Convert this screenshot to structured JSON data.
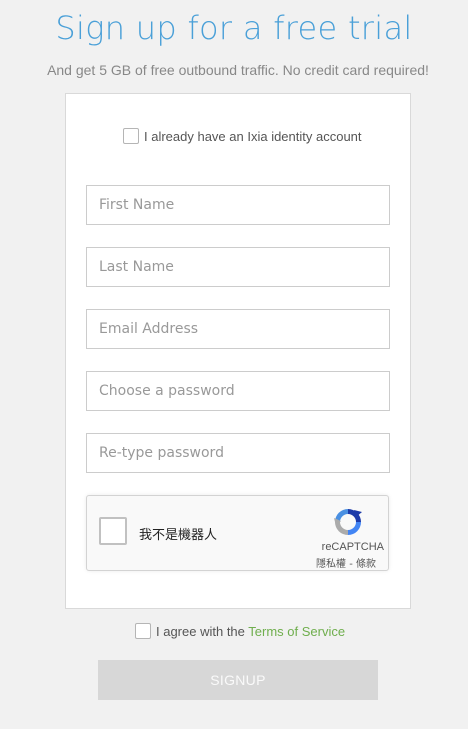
{
  "header": {
    "title": "Sign up for a free trial",
    "subtitle": "And get 5 GB of free outbound traffic. No credit card required!"
  },
  "form": {
    "identity_label": "I already have an Ixia identity account",
    "first_name_placeholder": "First Name",
    "last_name_placeholder": "Last Name",
    "email_placeholder": "Email Address",
    "password_placeholder": "Choose a password",
    "retype_password_placeholder": "Re-type password"
  },
  "recaptcha": {
    "label": "我不是機器人",
    "brand": "reCAPTCHA",
    "links": "隱私權 - 條款",
    "logo_icon": "recaptcha-logo-icon"
  },
  "agreement": {
    "prefix": "I agree with the",
    "terms_link": "Terms of Service"
  },
  "signup_label": "SIGNUP",
  "colors": {
    "title": "#4aa0d8",
    "link": "#6fae4d",
    "button_disabled": "#d7d7d7",
    "background": "#f1f1f1"
  }
}
